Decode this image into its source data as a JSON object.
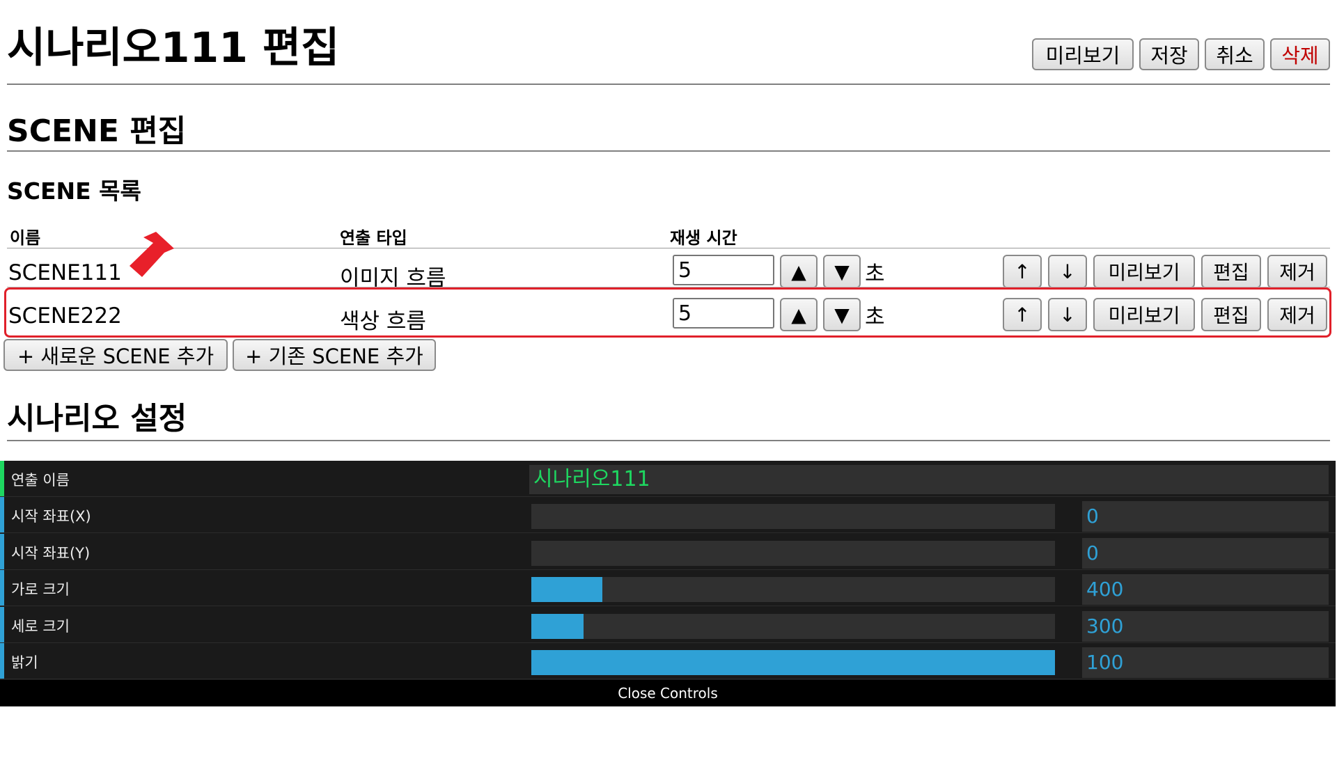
{
  "header": {
    "title": "시나리오111 편집",
    "buttons": {
      "preview": "미리보기",
      "save": "저장",
      "cancel": "취소",
      "delete": "삭제"
    }
  },
  "scene_section": {
    "heading": "SCENE 편집",
    "list_heading": "SCENE 목록",
    "columns": {
      "name": "이름",
      "type": "연출 타입",
      "duration": "재생 시간"
    },
    "rows": [
      {
        "name": "SCENE111",
        "type": "이미지 흐름",
        "duration": "5",
        "unit": "초"
      },
      {
        "name": "SCENE222",
        "type": "색상 흐름",
        "duration": "5",
        "unit": "초"
      }
    ],
    "row_buttons": {
      "up": "▲",
      "down": "▼",
      "move_up": "↑",
      "move_down": "↓",
      "preview": "미리보기",
      "edit": "편집",
      "remove": "제거"
    },
    "add_new": "+ 새로운 SCENE 추가",
    "add_existing": "+ 기존 SCENE 추가"
  },
  "settings": {
    "heading": "시나리오 설정",
    "name_label": "연출 이름",
    "name_value": "시나리오111",
    "start_x": {
      "label": "시작 좌표(X)",
      "value": "0",
      "fill": 0
    },
    "start_y": {
      "label": "시작 좌표(Y)",
      "value": "0",
      "fill": 0
    },
    "width": {
      "label": "가로 크기",
      "value": "400",
      "fill": 0.135
    },
    "height": {
      "label": "세로 크기",
      "value": "300",
      "fill": 0.1
    },
    "brightness": {
      "label": "밝기",
      "value": "100",
      "fill": 1.0
    },
    "close_label": "Close Controls"
  },
  "colors": {
    "accent_blue": "#2fa1d6",
    "accent_green": "#1ed760",
    "highlight_red": "#e0202a",
    "danger_text": "#c00000"
  }
}
